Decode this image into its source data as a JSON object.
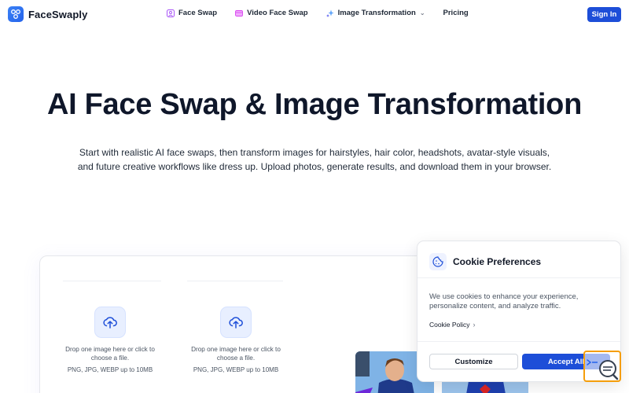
{
  "brand": {
    "name": "FaceSwaply",
    "accent": "#1d4ed8"
  },
  "nav": {
    "items": [
      {
        "label": "Face Swap",
        "icon": "face-swap-icon"
      },
      {
        "label": "Video Face Swap",
        "icon": "video-icon"
      },
      {
        "label": "Image Transformation",
        "icon": "sparkles-icon"
      },
      {
        "label": "Pricing"
      }
    ],
    "signin_label": "Sign In"
  },
  "hero": {
    "title": "AI Face Swap & Image Transformation",
    "subtitle_line1": "Start with realistic AI face swaps, then transform images for hairstyles, hair color, headshots, avatar-style visuals,",
    "subtitle_line2": "and future creative workflows like dress up. Upload photos, generate results, and download them in your browser."
  },
  "upload": {
    "drop_text_line1": "Drop one image here or click to",
    "drop_text_line2": "choose a file.",
    "hint": "PNG, JPG, WEBP up to 10MB"
  },
  "cookie": {
    "title": "Cookie Preferences",
    "text_line1": "We use cookies to enhance your experience,",
    "text_line2": "personalize content, and analyze traffic.",
    "policy_link": "Cookie Policy",
    "customize_label": "Customize",
    "accept_label": "Accept All"
  }
}
